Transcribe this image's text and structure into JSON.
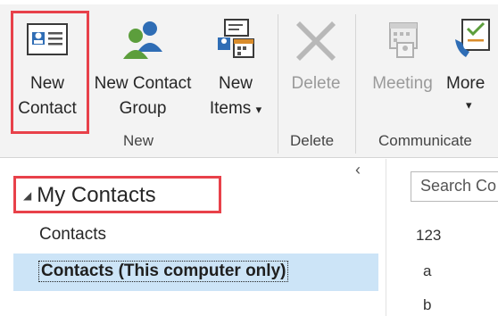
{
  "ribbon": {
    "groups": {
      "new": "New",
      "delete": "Delete",
      "communicate": "Communicate"
    },
    "buttons": {
      "new_contact_line1": "New",
      "new_contact_line2": "Contact",
      "new_contact_group_line1": "New Contact",
      "new_contact_group_line2": "Group",
      "new_items_line1": "New",
      "new_items_line2": "Items",
      "new_items_arrow": "▾",
      "delete": "Delete",
      "meeting": "Meeting",
      "more": "More",
      "more_arrow": "▾"
    }
  },
  "nav": {
    "collapse_glyph": "‹",
    "header": "My Contacts",
    "expand_glyph": "◢",
    "items": [
      "Contacts",
      "Contacts (This computer only)"
    ]
  },
  "list": {
    "search_placeholder": "Search Co",
    "index": [
      "123",
      "a",
      "b"
    ]
  },
  "colors": {
    "highlight": "#e8414a",
    "selection": "#cce4f7",
    "ribbon_bg": "#f3f3f3"
  }
}
